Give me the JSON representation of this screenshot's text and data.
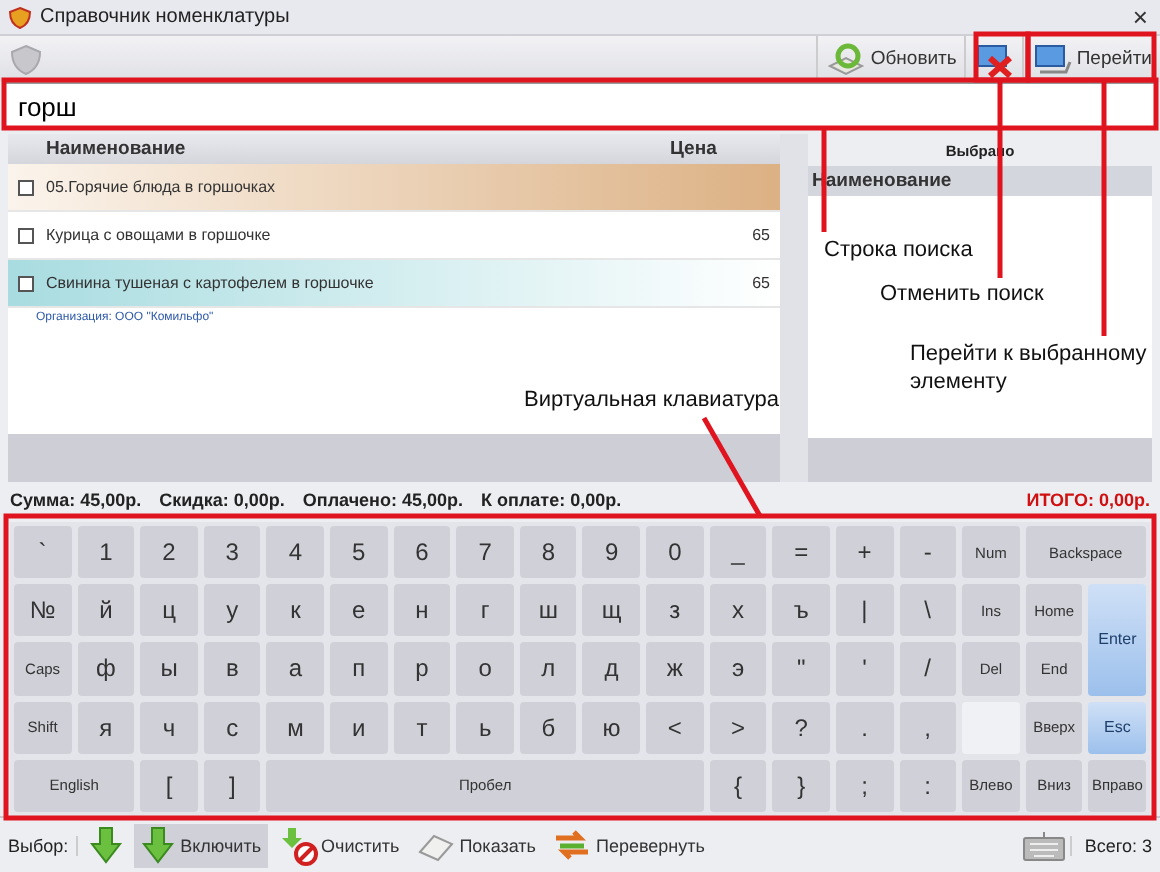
{
  "window": {
    "title": "Справочник номенклатуры",
    "close": "×"
  },
  "toolbar": {
    "buttons": [
      {
        "kind": "refresh",
        "label": "Обновить"
      },
      {
        "kind": "cancel"
      },
      {
        "kind": "goto",
        "label": "Перейти"
      }
    ]
  },
  "search": {
    "value": "горш"
  },
  "list": {
    "columns": [
      "Наименование",
      "Цена"
    ],
    "rows": [
      {
        "kind": "group",
        "name": "05.Горячие блюда в горшочках",
        "checked": false,
        "selected": false
      },
      {
        "kind": "item",
        "name": "Курица с овощами в горшочке",
        "price": "65",
        "checked": false,
        "selected": false
      },
      {
        "kind": "item",
        "name": "Свинина тушеная с картофелем в горшочке",
        "price": "65",
        "checked": false,
        "selected": true
      }
    ],
    "organization": "Организация: ООО \"Комильфо\""
  },
  "selected_panel": {
    "title": "Выбрано",
    "column": "Наименование"
  },
  "summary": {
    "items": [
      "Сумма: 45,00р.",
      "Скидка: 0,00р.",
      "Оплачено: 45,00р.",
      "К оплате: 0,00р."
    ],
    "total": "ИТОГО: 0,00р."
  },
  "keyboard": {
    "keys": [
      {
        "label": "`"
      },
      {
        "label": "1"
      },
      {
        "label": "2"
      },
      {
        "label": "3"
      },
      {
        "label": "4"
      },
      {
        "label": "5"
      },
      {
        "label": "6"
      },
      {
        "label": "7"
      },
      {
        "label": "8"
      },
      {
        "label": "9"
      },
      {
        "label": "0"
      },
      {
        "label": "_"
      },
      {
        "label": "="
      },
      {
        "label": "+"
      },
      {
        "label": "-"
      },
      {
        "label": "Num",
        "kind": "small"
      },
      {
        "label": "Backspace",
        "kind": "wide"
      },
      {
        "label": "№"
      },
      {
        "label": "й"
      },
      {
        "label": "ц"
      },
      {
        "label": "у"
      },
      {
        "label": "к"
      },
      {
        "label": "е"
      },
      {
        "label": "н"
      },
      {
        "label": "г"
      },
      {
        "label": "ш"
      },
      {
        "label": "щ"
      },
      {
        "label": "з"
      },
      {
        "label": "х"
      },
      {
        "label": "ъ"
      },
      {
        "label": "|"
      },
      {
        "label": "\\"
      },
      {
        "label": "Ins",
        "kind": "small"
      },
      {
        "label": "Home",
        "kind": "small"
      },
      {
        "label": "Enter",
        "kind": "tall"
      },
      {
        "label": "Caps",
        "kind": "small"
      },
      {
        "label": "ф"
      },
      {
        "label": "ы"
      },
      {
        "label": "в"
      },
      {
        "label": "а"
      },
      {
        "label": "п"
      },
      {
        "label": "р"
      },
      {
        "label": "о"
      },
      {
        "label": "л"
      },
      {
        "label": "д"
      },
      {
        "label": "ж"
      },
      {
        "label": "э"
      },
      {
        "label": "\""
      },
      {
        "label": "'"
      },
      {
        "label": "/"
      },
      {
        "label": "Del",
        "kind": "small"
      },
      {
        "label": "End",
        "kind": "small"
      },
      {
        "label": "Shift",
        "kind": "small"
      },
      {
        "label": "я"
      },
      {
        "label": "ч"
      },
      {
        "label": "с"
      },
      {
        "label": "м"
      },
      {
        "label": "и"
      },
      {
        "label": "т"
      },
      {
        "label": "ь"
      },
      {
        "label": "б"
      },
      {
        "label": "ю"
      },
      {
        "label": "<"
      },
      {
        "label": ">"
      },
      {
        "label": "?"
      },
      {
        "label": "."
      },
      {
        "label": ","
      },
      {
        "kind": "blank"
      },
      {
        "label": "Вверх",
        "kind": "small"
      },
      {
        "label": "Esc",
        "kind": "accent"
      },
      {
        "label": "English",
        "kind": "wide"
      },
      {
        "label": "["
      },
      {
        "label": "]"
      },
      {
        "label": "Пробел",
        "kind": "space"
      },
      {
        "label": "{"
      },
      {
        "label": "}"
      },
      {
        "label": ";"
      },
      {
        "label": ":"
      },
      {
        "label": "Влево",
        "kind": "small"
      },
      {
        "label": "Вниз",
        "kind": "small"
      },
      {
        "label": "Вправо",
        "kind": "small"
      }
    ]
  },
  "bottom_bar": {
    "label": "Выбор:",
    "buttons": [
      {
        "kind": "select-all",
        "selected": false
      },
      {
        "kind": "include",
        "label": "Включить",
        "selected": true
      },
      {
        "kind": "clear",
        "label": "Очистить",
        "selected": false
      },
      {
        "kind": "show",
        "label": "Показать",
        "selected": false
      },
      {
        "kind": "invert",
        "label": "Перевернуть",
        "selected": false
      }
    ],
    "total": "Всего: 3"
  },
  "annotations": [
    "Строка поиска",
    "Отменить поиск",
    "Перейти к выбранному элементу",
    "Виртуальная клавиатура"
  ]
}
